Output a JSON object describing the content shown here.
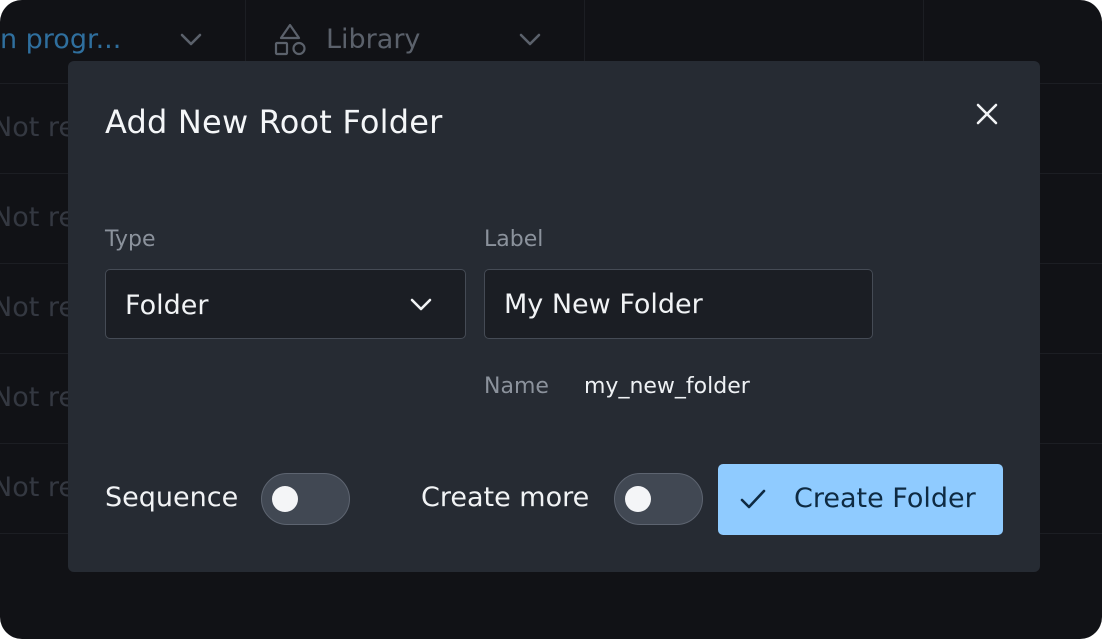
{
  "background": {
    "columns": [
      {
        "label": "In progr...",
        "icon": "chevron-down-icon"
      },
      {
        "label": "Library",
        "icon": "shapes-icon"
      }
    ],
    "rows": [
      "Not re",
      "Not re",
      "Not re",
      "Not re",
      "Not re"
    ]
  },
  "dialog": {
    "title": "Add New Root Folder",
    "close_icon": "close-icon",
    "type_label": "Type",
    "type_value": "Folder",
    "label_label": "Label",
    "label_value": "My New Folder",
    "name_label": "Name",
    "name_value": "my_new_folder",
    "sequence_label": "Sequence",
    "sequence_on": false,
    "create_more_label": "Create more",
    "create_more_on": false,
    "submit_label": "Create Folder",
    "submit_icon": "check-icon"
  },
  "colors": {
    "backdrop": "#111216",
    "modal": "#262b33",
    "accent": "#8fcbff",
    "link": "#2f6f9e"
  }
}
